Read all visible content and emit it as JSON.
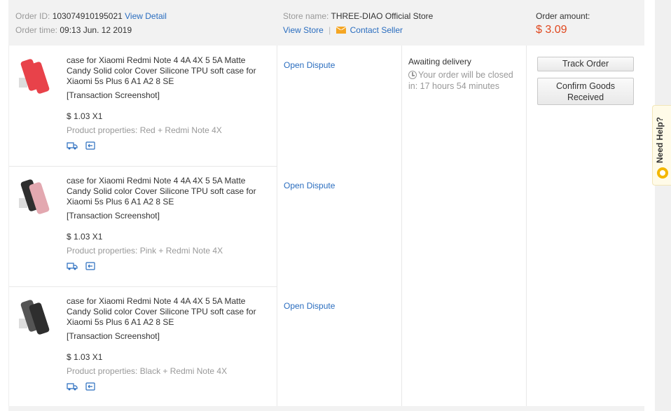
{
  "header": {
    "order_id_label": "Order ID:",
    "order_id": "103074910195021",
    "view_detail": "View Detail",
    "order_time_label": "Order time:",
    "order_time": "09:13 Jun. 12 2019",
    "store_label": "Store name:",
    "store_name": "THREE-DIAO Official Store",
    "view_store": "View Store",
    "separator": "|",
    "contact_seller": "Contact Seller",
    "amount_label": "Order amount:",
    "amount": "$ 3.09"
  },
  "products": [
    {
      "title": "case for Xiaomi Redmi Note 4 4A 4X 5 5A Matte Candy Solid color Cover Silicone TPU soft case for Xiaomi 5s Plus 6 A1 A2 8 SE",
      "screenshot": "[Transaction Screenshot]",
      "price": "$ 1.03 X1",
      "properties": "Product properties: Red + Redmi Note 4X",
      "dispute": "Open Dispute",
      "color": "#e8424a"
    },
    {
      "title": "case for Xiaomi Redmi Note 4 4A 4X 5 5A Matte Candy Solid color Cover Silicone TPU soft case for Xiaomi 5s Plus 6 A1 A2 8 SE",
      "screenshot": "[Transaction Screenshot]",
      "price": "$ 1.03 X1",
      "properties": "Product properties: Pink + Redmi Note 4X",
      "dispute": "Open Dispute",
      "color": "#e3a8b0"
    },
    {
      "title": "case for Xiaomi Redmi Note 4 4A 4X 5 5A Matte Candy Solid color Cover Silicone TPU soft case for Xiaomi 5s Plus 6 A1 A2 8 SE",
      "screenshot": "[Transaction Screenshot]",
      "price": "$ 1.03 X1",
      "properties": "Product properties: Black + Redmi Note 4X",
      "dispute": "Open Dispute",
      "color": "#2e2e2e"
    }
  ],
  "status": {
    "title": "Awaiting delivery",
    "timer": "Your order will be closed in: 17 hours 54 minutes"
  },
  "actions": {
    "track": "Track Order",
    "confirm": "Confirm Goods Received"
  },
  "help": {
    "label": "Need Help?"
  },
  "colors": {
    "link": "#2a6dbf",
    "amount": "#e0481f",
    "header_bg": "#f2f2f2"
  }
}
